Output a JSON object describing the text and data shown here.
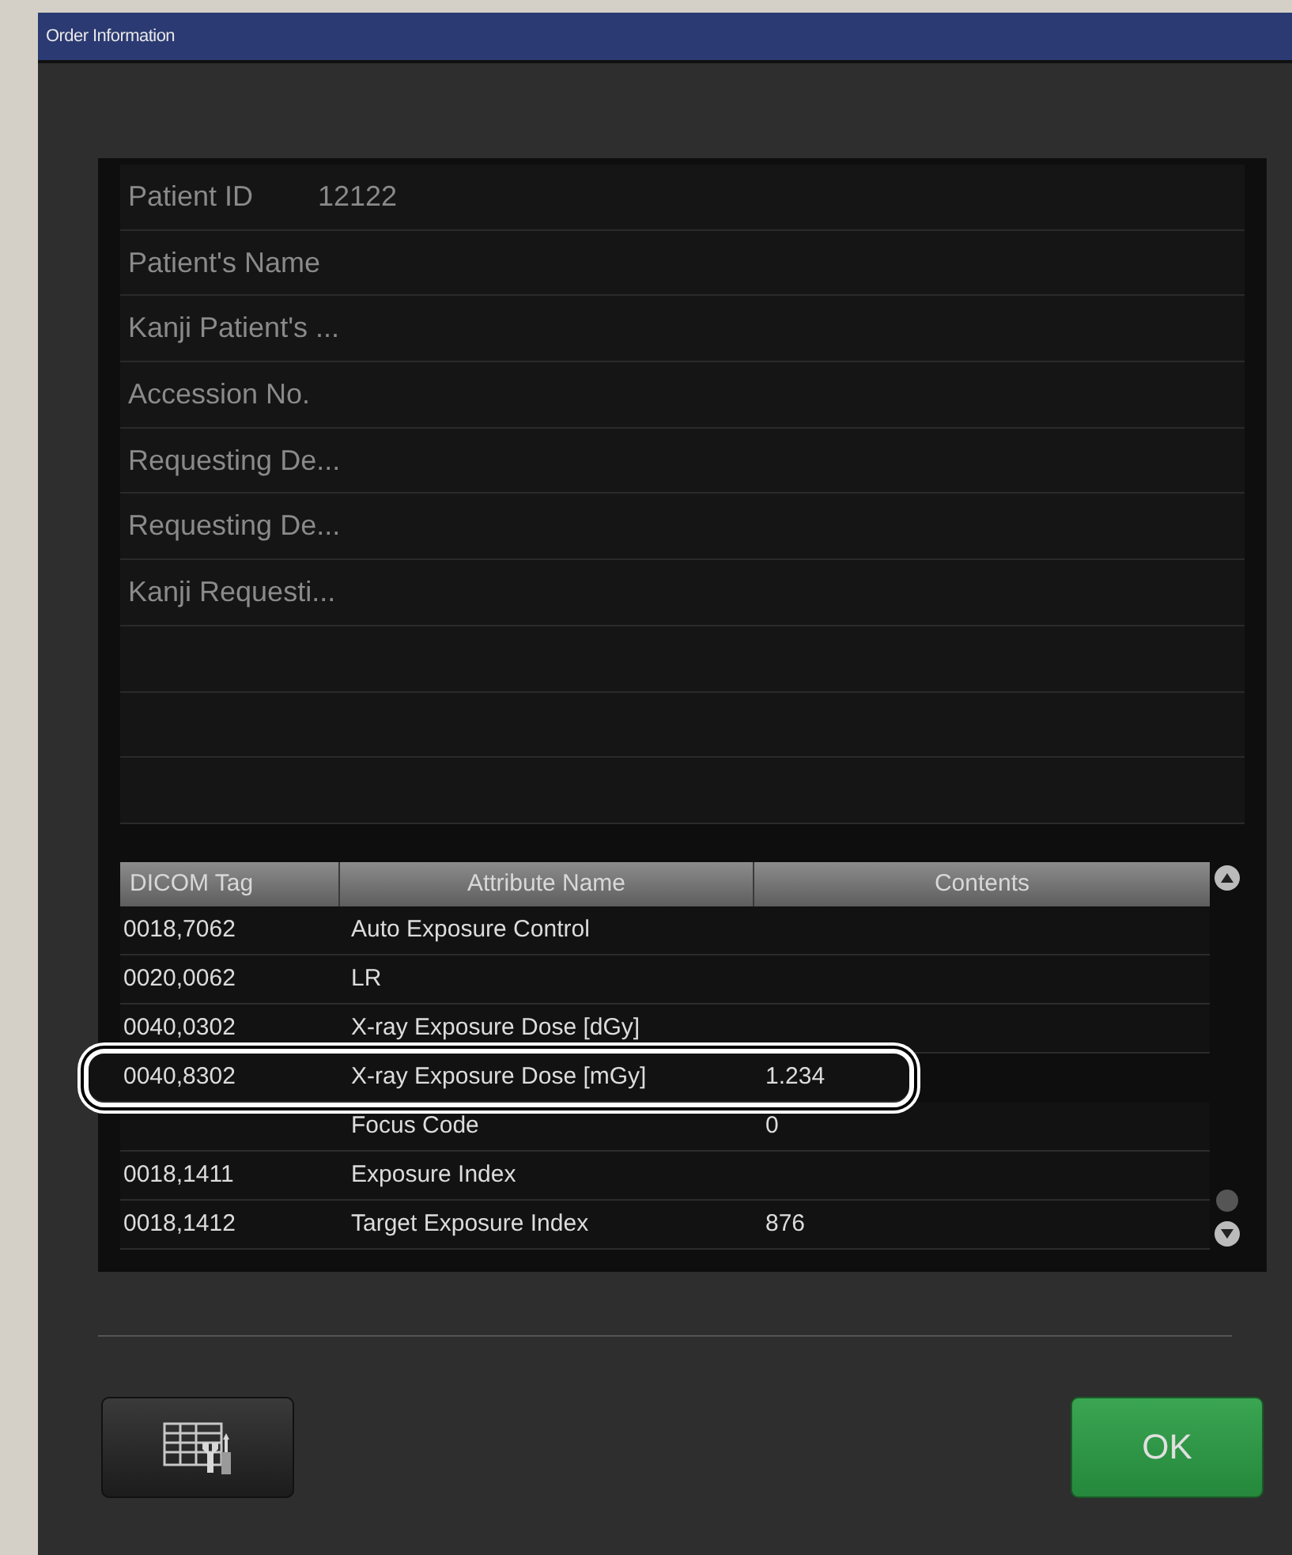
{
  "window": {
    "title": "Order Information"
  },
  "fields": [
    {
      "label": "Patient ID",
      "value": "12122"
    },
    {
      "label": "Patient's Name"
    },
    {
      "label": "Kanji Patient's ..."
    },
    {
      "label": "Accession No."
    },
    {
      "label": "Requesting De..."
    },
    {
      "label": "Requesting De..."
    },
    {
      "label": "Kanji Requesti..."
    }
  ],
  "table": {
    "columns": [
      "DICOM Tag",
      "Attribute Name",
      "Contents"
    ],
    "rows": [
      {
        "tag": "0018,7062",
        "attribute": "Auto Exposure Control",
        "highlighted": false
      },
      {
        "tag": "0020,0062",
        "attribute": "LR",
        "highlighted": false
      },
      {
        "tag": "0040,0302",
        "attribute": "X-ray Exposure Dose [dGy]",
        "highlighted": false
      },
      {
        "tag": "0040,8302",
        "attribute": "X-ray Exposure Dose [mGy]",
        "contents": "1.234",
        "highlighted": true
      },
      {
        "attribute": "Focus Code",
        "contents": "0",
        "highlighted": false
      },
      {
        "tag": "0018,1411",
        "attribute": "Exposure Index",
        "highlighted": false
      },
      {
        "tag": "0018,1412",
        "attribute": "Target Exposure Index",
        "contents": "876",
        "highlighted": false
      }
    ]
  },
  "buttons": {
    "ok": "OK"
  }
}
